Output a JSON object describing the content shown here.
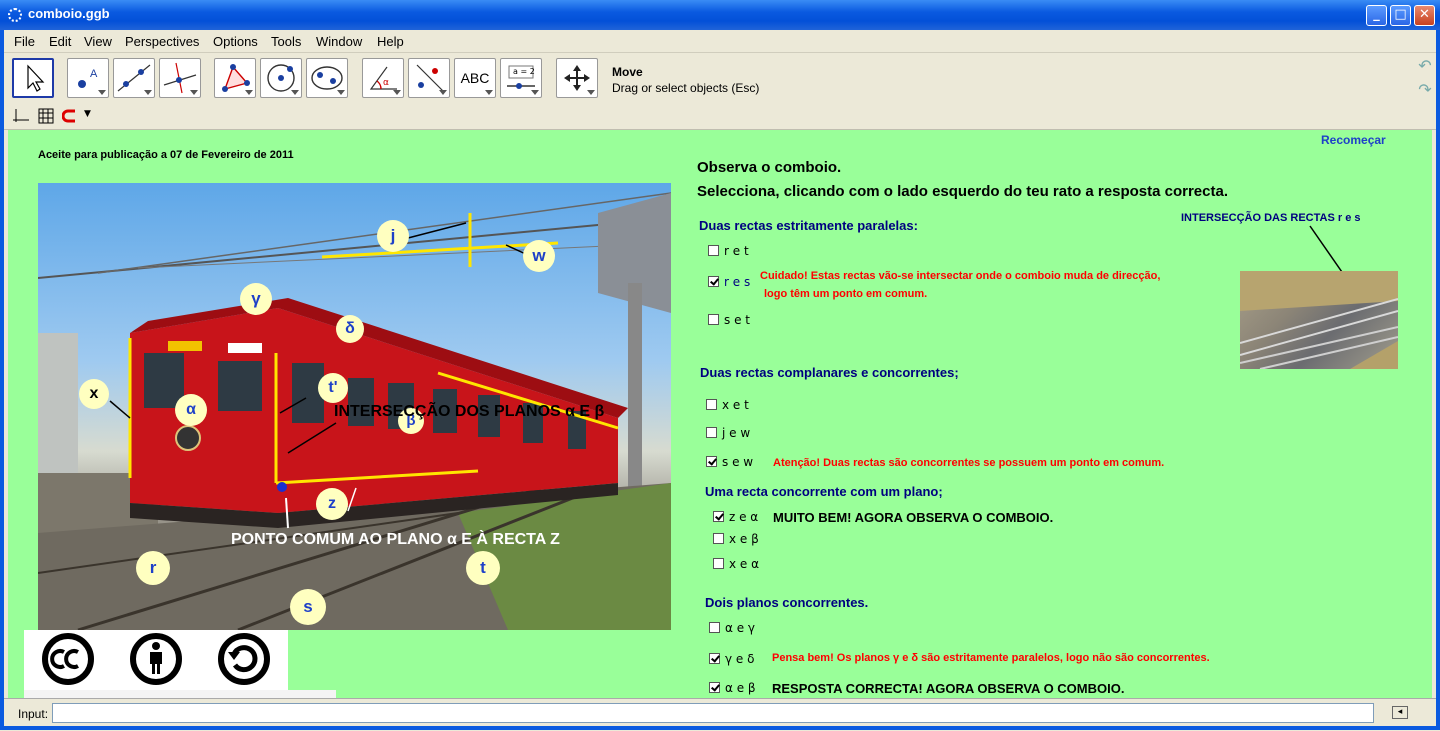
{
  "window": {
    "title": "comboio.ggb",
    "minimize": "_",
    "maximize": "□",
    "close": "✕"
  },
  "menu": [
    "File",
    "Edit",
    "View",
    "Perspectives",
    "Options",
    "Tools",
    "Window",
    "Help"
  ],
  "toolbar": {
    "tool_title": "Move",
    "tool_desc": "Drag or select objects (Esc)",
    "abc_label": "ABC",
    "slider_label": "a = 2"
  },
  "icons": [
    "move-icon",
    "point-icon",
    "line-icon",
    "perpendicular-icon",
    "polygon-icon",
    "circle-icon",
    "conic-icon",
    "angle-icon",
    "reflect-icon",
    "text-icon",
    "slider-icon",
    "move-view-icon",
    "undo-icon",
    "redo-icon"
  ],
  "view": {
    "recomecar": "Recomeçar",
    "accepted": "Aceite para publicação a 07 de Fevereiro de 2011",
    "intro1": "Observa o comboio.",
    "intro2": "Selecciona, clicando com  o lado esquerdo do teu rato a resposta correcta.",
    "photo_labels": {
      "j": "j",
      "w": "w",
      "gamma": "γ",
      "delta": "δ",
      "x": "x",
      "alpha": "α",
      "tprime": "t'",
      "beta": "β",
      "z": "z",
      "r": "r",
      "t": "t",
      "s": "s"
    },
    "planes_text": "INTERSECÇÃO DOS PLANOS α E β",
    "point_text": "PONTO COMUM AO PLANO α E À RECTA Z",
    "inset_title": "INTERSECÇÃO DAS RECTAS r e s",
    "sections": [
      {
        "title": "Duas rectas estritamente  paralelas:",
        "options": [
          {
            "label": "r e t",
            "checked": false
          },
          {
            "label": "r e s",
            "checked": true
          },
          {
            "label": "s e t",
            "checked": false
          }
        ],
        "feedback": [
          "Cuidado! Estas rectas vão-se intersectar onde o comboio muda de direcção,",
          "logo têm um ponto em comum."
        ]
      },
      {
        "title": "Duas rectas complanares e concorrentes;",
        "options": [
          {
            "label": "x e t",
            "checked": false
          },
          {
            "label": "j e w",
            "checked": false
          },
          {
            "label": "s e w",
            "checked": true
          }
        ],
        "feedback": [
          "Atenção! Duas rectas são concorrentes se possuem um ponto em comum."
        ]
      },
      {
        "title": "Uma recta concorrente com um plano;",
        "options": [
          {
            "label": "z e α",
            "checked": true
          },
          {
            "label": "x e β",
            "checked": false
          },
          {
            "label": "x e α",
            "checked": false
          }
        ],
        "feedback": [
          "MUITO BEM! AGORA OBSERVA O COMBOIO."
        ]
      },
      {
        "title": "Dois planos concorrentes.",
        "options": [
          {
            "label": "α e γ",
            "checked": false
          },
          {
            "label": "γ e δ",
            "checked": true
          },
          {
            "label": "α e β",
            "checked": true
          }
        ],
        "feedback": [
          "Pensa bem! Os planos γ e δ são estritamente paralelos, logo não são concorrentes.",
          "RESPOSTA CORRECTA! AGORA OBSERVA O COMBOIO."
        ]
      }
    ]
  },
  "input": {
    "label": "Input:",
    "value": ""
  },
  "colors": {
    "view_bg": "#99ff99",
    "navy": "#000080",
    "red": "#ff0000",
    "link": "#1e40c8",
    "titlebar": "#0a5ae0"
  }
}
